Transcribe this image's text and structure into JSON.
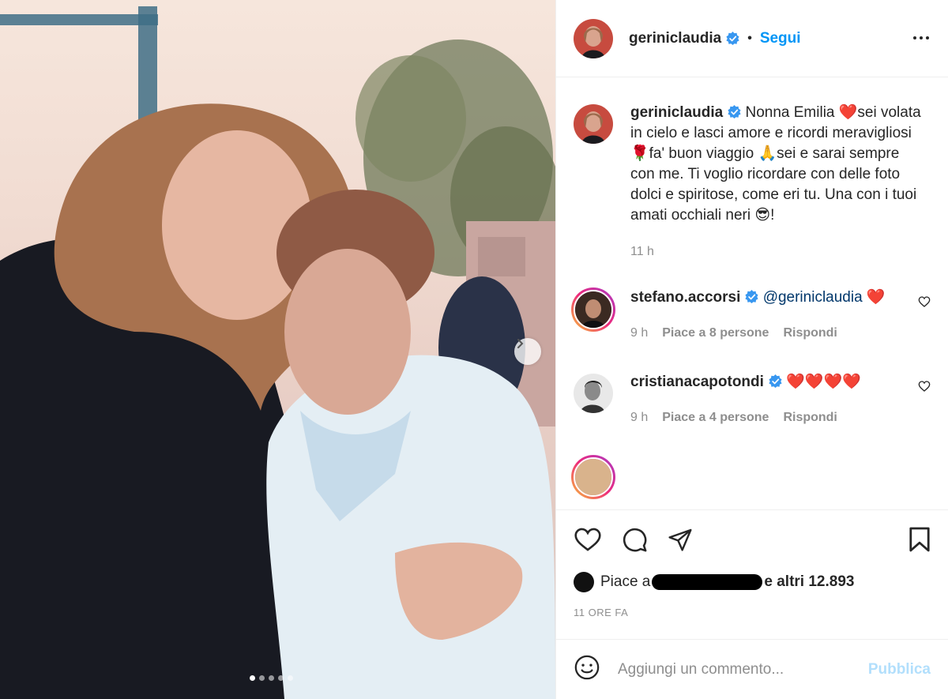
{
  "post": {
    "username": "geriniclaudia",
    "follow_label": "Segui",
    "separator": "•",
    "caption": "Nonna Emilia ❤️sei volata in cielo e lasci amore e ricordi meravigliosi 🌹fa' buon viaggio 🙏sei e sarai sempre con me. Ti voglio ricordare con delle foto dolci e spiritose, come eri tu. Una con i tuoi amati occhiali neri 😎!",
    "caption_time": "11 h",
    "carousel": {
      "current": 1,
      "total": 5
    }
  },
  "comments": [
    {
      "username": "stefano.accorsi",
      "mention": "@geriniclaudia",
      "text": " ❤️",
      "time": "9 h",
      "likes_label": "Piace a 8 persone",
      "reply_label": "Rispondi"
    },
    {
      "username": "cristianacapotondi",
      "text": "❤️❤️❤️❤️",
      "time": "9 h",
      "likes_label": "Piace a 4 persone",
      "reply_label": "Rispondi"
    }
  ],
  "likes": {
    "prefix": "Piace a",
    "suffix": "e altri 12.893"
  },
  "timestamp": "11 ORE FA",
  "add_comment": {
    "placeholder": "Aggiungi un commento...",
    "publish_label": "Pubblica"
  },
  "icons": {
    "like": "heart-icon",
    "comment": "comment-icon",
    "share": "paper-plane-icon",
    "save": "bookmark-icon",
    "more": "more-horizontal-icon",
    "emoji": "emoji-icon",
    "next": "chevron-right-icon"
  },
  "colors": {
    "accent": "#0095f6",
    "muted": "#8e8e8e",
    "publish_disabled": "#b2dffc"
  }
}
